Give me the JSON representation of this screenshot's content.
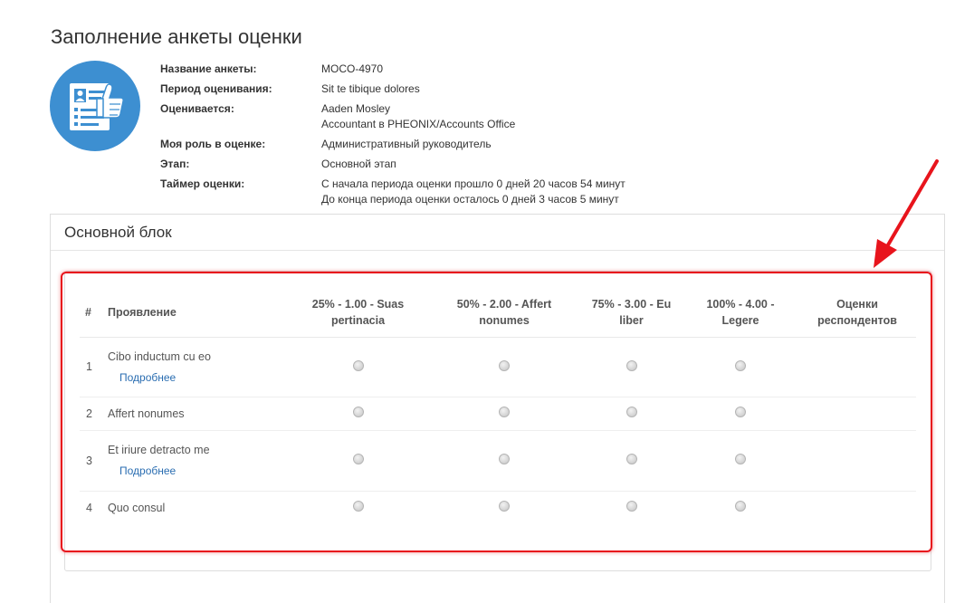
{
  "page": {
    "title": "Заполнение анкеты оценки"
  },
  "info": [
    {
      "label": "Название анкеты:",
      "values": [
        "MOCO-4970"
      ]
    },
    {
      "label": "Период оценивания:",
      "values": [
        "Sit te tibique dolores"
      ]
    },
    {
      "label": "Оценивается:",
      "values": [
        "Aaden Mosley",
        "Accountant в PHEONIX/Accounts Office"
      ]
    },
    {
      "label": "Моя роль в оценке:",
      "values": [
        "Административный руководитель"
      ]
    },
    {
      "label": "Этап:",
      "values": [
        "Основной этап"
      ]
    },
    {
      "label": "Таймер оценки:",
      "values": [
        "С начала периода оценки прошло 0 дней 20 часов 54 минут",
        "До конца периода оценки осталось 0 дней 3 часов 5 минут"
      ]
    }
  ],
  "block": {
    "title": "Основной блок",
    "columns": {
      "num": "#",
      "name": "Проявление",
      "scale": [
        "25% - 1.00 - Suas pertinacia",
        "50% - 2.00 - Affert nonumes",
        "75% - 3.00 - Eu liber",
        "100% - 4.00 - Legere"
      ],
      "respondents": "Оценки респондентов"
    },
    "rows": [
      {
        "num": "1",
        "name": "Cibo inductum cu eo",
        "more": "Подробнее"
      },
      {
        "num": "2",
        "name": "Affert nonumes",
        "more": ""
      },
      {
        "num": "3",
        "name": "Et iriure detracto me",
        "more": "Подробнее"
      },
      {
        "num": "4",
        "name": "Quo consul",
        "more": ""
      }
    ]
  },
  "colors": {
    "accent": "#3d8fd1",
    "link": "#2a6db1",
    "highlight": "#e8141c"
  },
  "icons": {
    "avatar": "appraisal-form-thumbs-up-icon",
    "arrow": "red-arrow-icon"
  }
}
